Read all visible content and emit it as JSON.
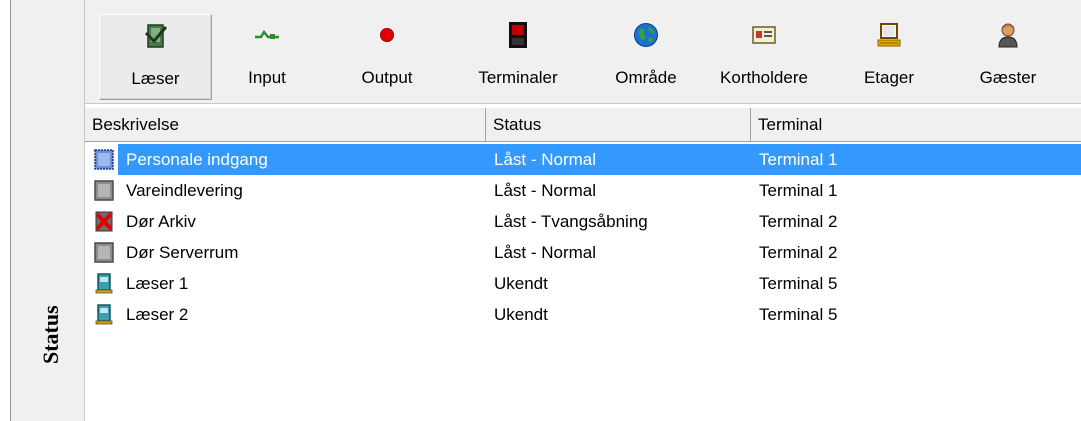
{
  "rail": {
    "label": "Status"
  },
  "toolbar": {
    "items": [
      {
        "label": "Læser",
        "icon": "door-reader-icon"
      },
      {
        "label": "Input",
        "icon": "plug-input-icon"
      },
      {
        "label": "Output",
        "icon": "red-dot-output-icon"
      },
      {
        "label": "Terminaler",
        "icon": "terminal-icon"
      },
      {
        "label": "Område",
        "icon": "globe-icon"
      },
      {
        "label": "Kortholdere",
        "icon": "id-card-icon"
      },
      {
        "label": "Etager",
        "icon": "floor-icon"
      },
      {
        "label": "Gæster",
        "icon": "person-icon"
      }
    ],
    "selected_index": 0
  },
  "table": {
    "columns": [
      "Beskrivelse",
      "Status",
      "Terminal"
    ],
    "rows": [
      {
        "description": "Personale indgang",
        "status": "Låst - Normal",
        "terminal": "Terminal 1",
        "icon": "door-locked-icon",
        "selected": true
      },
      {
        "description": "Vareindlevering",
        "status": "Låst - Normal",
        "terminal": "Terminal 1",
        "icon": "door-locked-icon",
        "selected": false
      },
      {
        "description": "Dør Arkiv",
        "status": "Låst - Tvangsåbning",
        "terminal": "Terminal 2",
        "icon": "door-alarm-icon",
        "selected": false
      },
      {
        "description": "Dør Serverrum",
        "status": "Låst - Normal",
        "terminal": "Terminal 2",
        "icon": "door-locked-icon",
        "selected": false
      },
      {
        "description": "Læser 1",
        "status": "Ukendt",
        "terminal": "Terminal 5",
        "icon": "reader-device-icon",
        "selected": false
      },
      {
        "description": "Læser 2",
        "status": "Ukendt",
        "terminal": "Terminal 5",
        "icon": "reader-device-icon",
        "selected": false
      }
    ]
  },
  "colors": {
    "selection": "#3399ff",
    "toolbar_bg": "#f0f0f0"
  }
}
